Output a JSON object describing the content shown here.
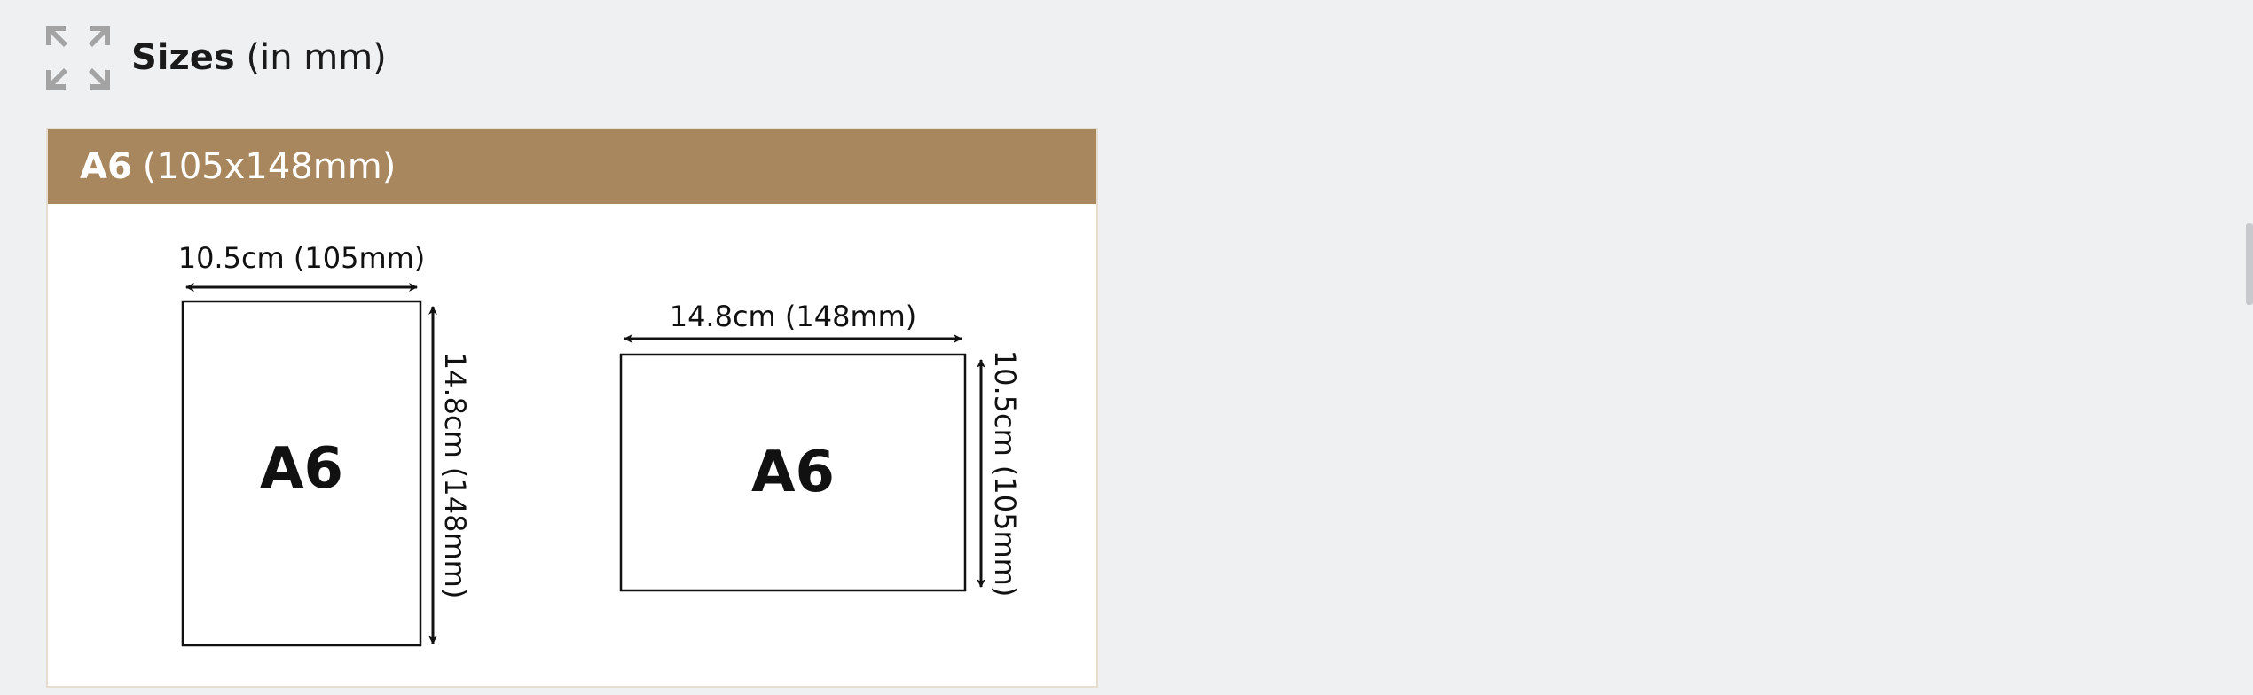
{
  "header": {
    "icon": "expand-arrows-icon",
    "title_strong": "Sizes",
    "title_unit": "(in mm)"
  },
  "card": {
    "size_name": "A6",
    "size_dims": "(105x148mm)",
    "accent_color": "#a8875e",
    "portrait": {
      "label": "A6",
      "width_label": "10.5cm (105mm)",
      "height_label": "14.8cm (148mm)"
    },
    "landscape": {
      "label": "A6",
      "width_label": "14.8cm (148mm)",
      "height_label": "10.5cm (105mm)"
    }
  }
}
